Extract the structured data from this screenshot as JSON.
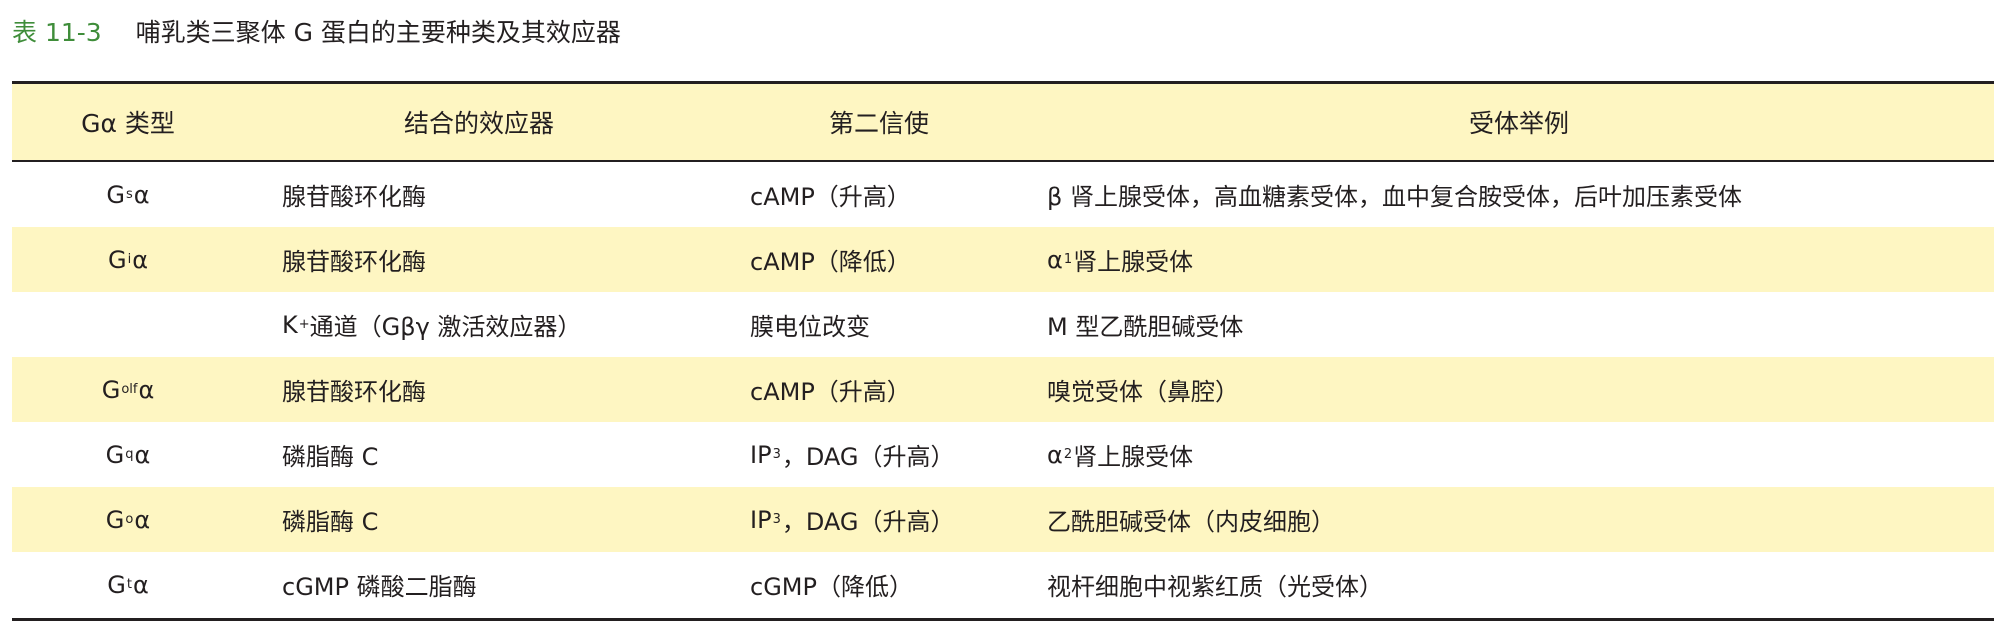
{
  "caption": {
    "label": "表 11-3",
    "title": "哺乳类三聚体 G 蛋白的主要种类及其效应器"
  },
  "table": {
    "headers": [
      "Gα 类型",
      "结合的效应器",
      "第二信使",
      "受体举例"
    ],
    "rows": [
      {
        "g_type": {
          "base": "G",
          "sub": "s",
          "tail": "α"
        },
        "effector": {
          "main": "腺苷酸环化酶"
        },
        "messenger": {
          "main": "cAMP（升高）"
        },
        "receptor": {
          "main": "β 肾上腺受体，高血糖素受体，血中复合胺受体，后叶加压素受体"
        }
      },
      {
        "g_type": {
          "base": "G",
          "sub": "i",
          "tail": "α"
        },
        "effector": {
          "main": "腺苷酸环化酶"
        },
        "messenger": {
          "main": "cAMP（降低）"
        },
        "receptor": {
          "base": "α",
          "sub": "1",
          "tail": " 肾上腺受体"
        }
      },
      {
        "g_type": {
          "base": "",
          "sub": "",
          "tail": ""
        },
        "effector": {
          "base": "K",
          "sup": "+",
          "tail": " 通道（Gβγ 激活效应器）"
        },
        "messenger": {
          "main": "膜电位改变"
        },
        "receptor": {
          "main": "M 型乙酰胆碱受体"
        }
      },
      {
        "g_type": {
          "base": "G",
          "sub": "olf",
          "tail": "α"
        },
        "effector": {
          "main": "腺苷酸环化酶"
        },
        "messenger": {
          "main": "cAMP（升高）"
        },
        "receptor": {
          "main": "嗅觉受体（鼻腔）"
        }
      },
      {
        "g_type": {
          "base": "G",
          "sub": "q",
          "tail": "α"
        },
        "effector": {
          "main": "磷脂酶 C"
        },
        "messenger": {
          "base": "IP",
          "sub": "3",
          "tail": "，DAG（升高）"
        },
        "receptor": {
          "base": "α",
          "sub": "2",
          "tail": " 肾上腺受体"
        }
      },
      {
        "g_type": {
          "base": "G",
          "sub": "o",
          "tail": "α"
        },
        "effector": {
          "main": "磷脂酶 C"
        },
        "messenger": {
          "base": "IP",
          "sub": "3",
          "tail": "，DAG（升高）"
        },
        "receptor": {
          "main": "乙酰胆碱受体（内皮细胞）"
        }
      },
      {
        "g_type": {
          "base": "G",
          "sub": "t",
          "tail": "α"
        },
        "effector": {
          "main": "cGMP 磷酸二脂酶"
        },
        "messenger": {
          "main": "cGMP（降低）"
        },
        "receptor": {
          "main": "视杆细胞中视紫红质（光受体）"
        }
      }
    ]
  },
  "colors": {
    "caption_label": "#3f8d3a",
    "header_fill": "#fef6c2",
    "row_fill": "#fef6c2",
    "text": "#231f20"
  }
}
